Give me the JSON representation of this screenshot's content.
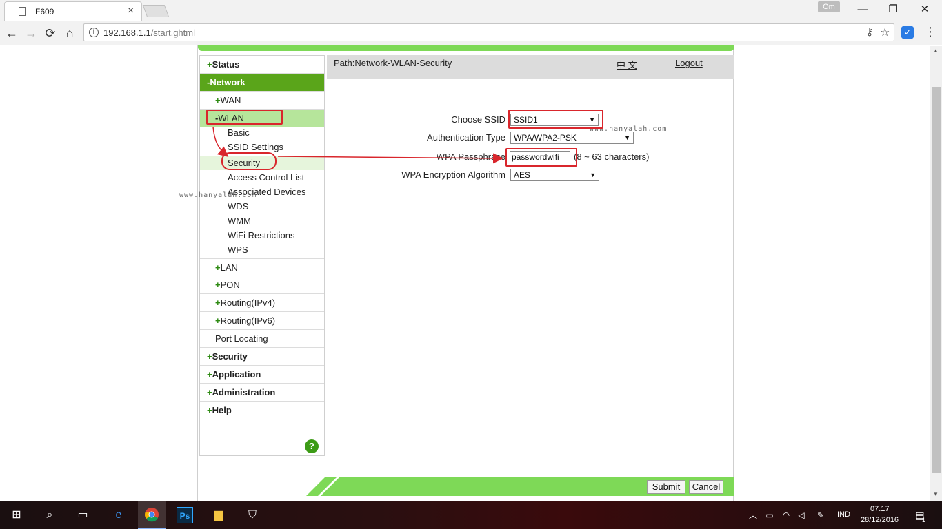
{
  "browser": {
    "tab_title": "F609",
    "tab_close": "×",
    "profile_label": "Om",
    "win_minimize": "—",
    "win_restore": "❐",
    "win_close": "✕",
    "back": "←",
    "forward": "→",
    "reload": "⟳",
    "home": "⌂",
    "url_host": "192.168.1.1",
    "url_path": "/start.ghtml",
    "menu": "⋮"
  },
  "sidebar": {
    "status": "Status",
    "network": "Network",
    "wan": "WAN",
    "wlan": "WLAN",
    "wlan_items": [
      "Basic",
      "SSID Settings",
      "Security",
      "Access Control List",
      "Associated Devices",
      "WDS",
      "WMM",
      "WiFi Restrictions",
      "WPS"
    ],
    "lan": "LAN",
    "pon": "PON",
    "routing_ipv4": "Routing(IPv4)",
    "routing_ipv6": "Routing(IPv6)",
    "port_locating": "Port Locating",
    "security": "Security",
    "application": "Application",
    "administration": "Administration",
    "help": "Help",
    "plus_sign": "+",
    "minus_sign": "-",
    "help_icon": "?"
  },
  "header": {
    "path": "Path:Network-WLAN-Security",
    "language": "中 文",
    "logout": "Logout"
  },
  "form": {
    "ssid_label": "Choose SSID",
    "ssid_value": "SSID1",
    "auth_label": "Authentication Type",
    "auth_value": "WPA/WPA2-PSK",
    "passphrase_label": "WPA Passphrase",
    "passphrase_value": "passwordwifi",
    "passphrase_hint": "(8 ~ 63 characters)",
    "encryption_label": "WPA Encryption Algorithm",
    "encryption_value": "AES"
  },
  "watermark": "www.hanyalah.com",
  "buttons": {
    "submit": "Submit",
    "cancel": "Cancel"
  },
  "taskbar": {
    "language": "IND",
    "time": "07.17",
    "date": "28/12/2016",
    "notifications": "1"
  },
  "colors": {
    "accent_green": "#5aa51a",
    "light_green": "#7ed957",
    "highlight_red": "#d9262c"
  }
}
